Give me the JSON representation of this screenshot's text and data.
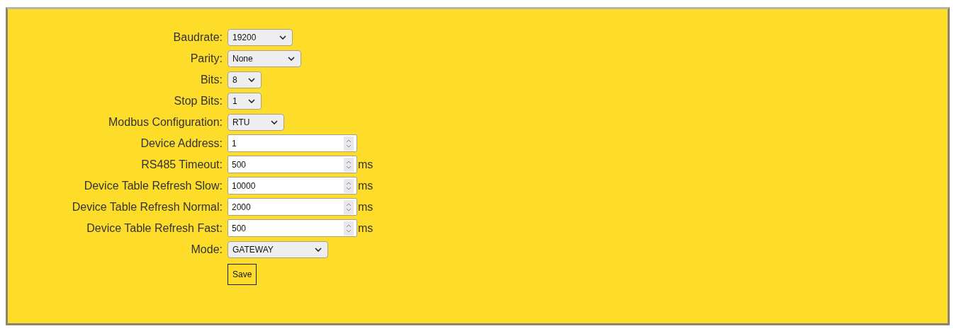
{
  "fields": [
    {
      "label": "Baudrate:",
      "kind": "select",
      "value": "19200"
    },
    {
      "label": "Parity:",
      "kind": "select",
      "value": "None"
    },
    {
      "label": "Bits:",
      "kind": "select",
      "value": "8"
    },
    {
      "label": "Stop Bits:",
      "kind": "select",
      "value": "1"
    },
    {
      "label": "Modbus Configuration:",
      "kind": "select",
      "value": "RTU"
    },
    {
      "label": "Device Address:",
      "kind": "number",
      "value": "1"
    },
    {
      "label": "RS485 Timeout:",
      "kind": "number",
      "value": "500",
      "unit": "ms"
    },
    {
      "label": "Device Table Refresh Slow:",
      "kind": "number",
      "value": "10000",
      "unit": "ms"
    },
    {
      "label": "Device Table Refresh Normal:",
      "kind": "number",
      "value": "2000",
      "unit": "ms"
    },
    {
      "label": "Device Table Refresh Fast:",
      "kind": "number",
      "value": "500",
      "unit": "ms"
    },
    {
      "label": "Mode:",
      "kind": "select",
      "value": "GATEWAY"
    }
  ],
  "save_button": "Save"
}
